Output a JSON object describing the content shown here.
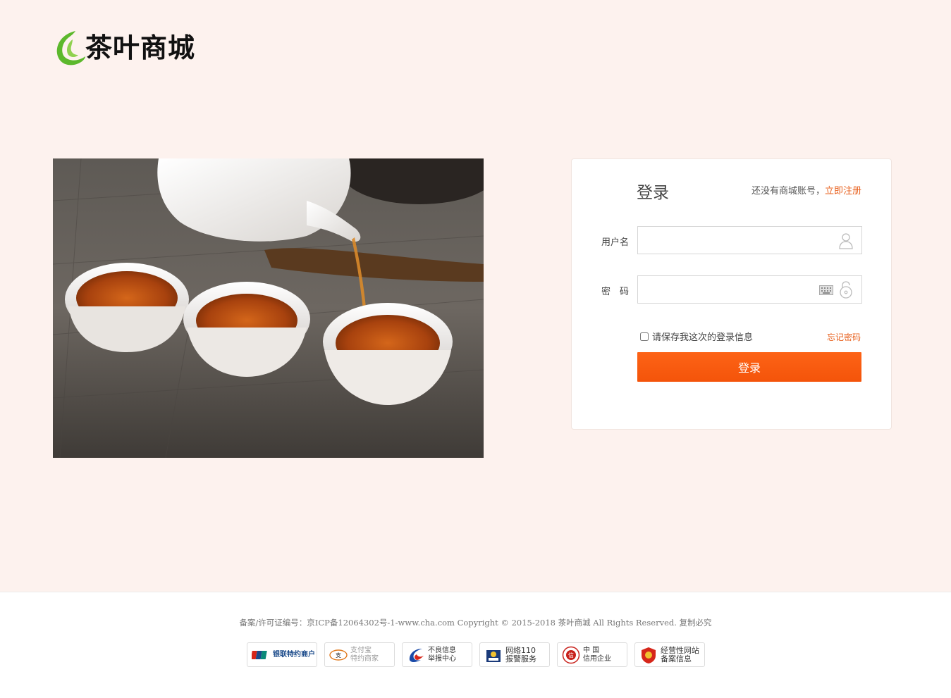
{
  "brand": {
    "name": "茶叶商城",
    "logo_color": "#5cb82c"
  },
  "login": {
    "title": "登录",
    "register_prompt": "还没有商城账号，",
    "register_link": "立即注册",
    "username_label": "用户名",
    "password_label": "密　码",
    "username_value": "",
    "password_value": "",
    "remember_label": "请保存我这次的登录信息",
    "forgot_label": "忘记密码",
    "submit_label": "登录",
    "accent_color": "#fa5a0f"
  },
  "footer": {
    "copyright": "备案/许可证编号：京ICP备12064302号-1-www.cha.com Copyright © 2015-2018 茶叶商城 All Rights Reserved. 复制必究",
    "badges": [
      {
        "icon": "unionpay-icon",
        "line1": "银联特约商户",
        "line2": ""
      },
      {
        "icon": "alipay-icon",
        "line1": "支付宝",
        "line2": "特约商家"
      },
      {
        "icon": "report-center-icon",
        "line1": "不良信息",
        "line2": "举报中心"
      },
      {
        "icon": "police-110-icon",
        "line1": "网络110",
        "line2": "报警服务"
      },
      {
        "icon": "trust-seal-icon",
        "line1": "中 国",
        "line2": "信用企业"
      },
      {
        "icon": "website-filing-icon",
        "line1": "经营性网站",
        "line2": "备案信息"
      }
    ]
  }
}
